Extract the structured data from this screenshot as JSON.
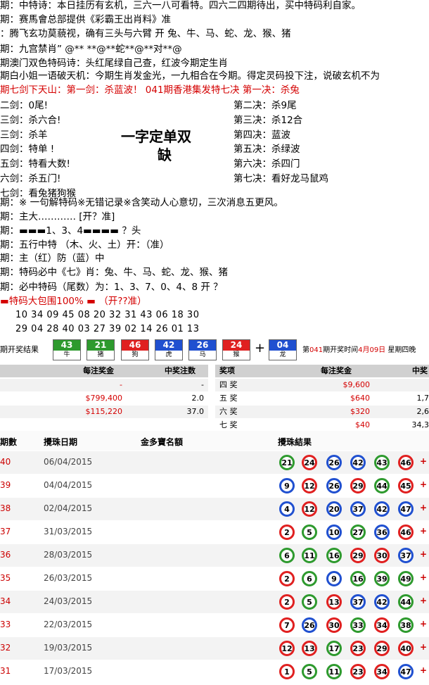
{
  "lines": [
    {
      "text": "期：中特诗：本日挂历有玄机，三六一八可看特。四六二四期待出，买中特码利自家。",
      "color": "#000000"
    },
    {
      "text": "期：赛馬會总部提供《彩霸王出肖料》准",
      "color": "#000000"
    },
    {
      "text": "：腾飞玄功莫藐视，确有三头与六臂        开 兔、牛、马、蛇、龙、猴、猪",
      "color": "#000000"
    },
    {
      "text": "期：九宫禁肖” @** **@**蛇**@**对**@",
      "color": "#000000"
    },
    {
      "text": "期澳门双色特码诗：头红尾绿自己查，红波今期定生肖",
      "color": "#000000"
    },
    {
      "text": "期白小姐一语破天机：今期生肖发金光，一九相合在今期。得定灵码投下注，说破玄机不为",
      "color": "#000000"
    },
    {
      "text": "期七剑下天山：第一剑：杀蓝波！      041期香港集发特七决 第一决：杀兔",
      "color": "#d40000"
    }
  ],
  "swords": [
    {
      "left": "二剑：0尾!",
      "right": "第二决：杀9尾"
    },
    {
      "left": "三剑：杀六合!",
      "right": "第三决：杀12合"
    },
    {
      "left": "三剑：杀羊",
      "right": "第四决：蓝波"
    },
    {
      "left": "四剑：特单 !",
      "right": "第五决：杀绿波"
    },
    {
      "left": "五剑：特看大数!",
      "right": "第六决：杀四门"
    },
    {
      "left": "六剑：杀五门!",
      "right": "第七决：看好龙马鼠鸡"
    },
    {
      "left": "七剑：看兔猪狗猴",
      "right": ""
    }
  ],
  "big_text_1": "一字定单双",
  "big_text_2": "缺",
  "lines2": [
    {
      "text": "期：※ 一句解特码※无错记录※含笑动人心意切，三次消息五更风。",
      "color": "#000000"
    },
    {
      "text": "期：主大………… [开？准]",
      "color": "#000000"
    },
    {
      "text": "期：▬▬▬1、3、4▬▬▬▬ ？头",
      "color": "#000000"
    },
    {
      "text": "期：五行中特  （木、火、土）开：（准）",
      "color": "#000000"
    },
    {
      "text": "期：主（红）防（蓝）中",
      "color": "#000000"
    },
    {
      "text": "期：特码必中《七》肖：兔、牛、马、蛇、龙、猴、猪",
      "color": "#000000"
    },
    {
      "text": "期：必中特码（尾数）为：1、3、7、0、4、8     开 ？",
      "color": "#000000"
    },
    {
      "text": "▬特码大包围100% ▬  （开??准）",
      "color": "#d40000"
    }
  ],
  "numbers_row1": "10 34 09 45 08 20 32 31 43 06 18 30",
  "numbers_row2": "29 04 28 40 03 27 39 02 14 26 01 13",
  "draw": {
    "label": "期开奖结果",
    "balls": [
      {
        "num": "43",
        "zodiac": "牛",
        "color": "#2e9a2e"
      },
      {
        "num": "21",
        "zodiac": "猪",
        "color": "#2e9a2e"
      },
      {
        "num": "46",
        "zodiac": "狗",
        "color": "#e02020"
      },
      {
        "num": "42",
        "zodiac": "虎",
        "color": "#2050d0"
      },
      {
        "num": "26",
        "zodiac": "马",
        "color": "#2050d0"
      },
      {
        "num": "24",
        "zodiac": "猴",
        "color": "#e02020"
      }
    ],
    "special": {
      "num": "04",
      "zodiac": "龙",
      "color": "#2050d0"
    },
    "plus": "+",
    "info_prefix": "第",
    "info_issue": "041",
    "info_mid": "期开奖时间",
    "info_date": "4月09日",
    "info_suffix": "星期四晚"
  },
  "prize_left": {
    "headers": [
      "每注奖金",
      "中奖注数"
    ],
    "rows": [
      {
        "amount": "-",
        "count": "-"
      },
      {
        "amount": "$799,400",
        "count": "2.0"
      },
      {
        "amount": "$115,220",
        "count": "37.0"
      }
    ]
  },
  "prize_right": {
    "headers": [
      "奖项",
      "每注奖金",
      "中奖"
    ],
    "rows": [
      {
        "name": "四 奖",
        "amount": "$9,600",
        "count": ""
      },
      {
        "name": "五 奖",
        "amount": "$640",
        "count": "1,7"
      },
      {
        "name": "六 奖",
        "amount": "$320",
        "count": "2,6"
      },
      {
        "name": "七 奖",
        "amount": "$40",
        "count": "34,3"
      }
    ]
  },
  "history": {
    "headers": [
      "期數",
      "攪珠日期",
      "金多寶名額",
      "攪珠結果"
    ],
    "rows": [
      {
        "no": "40",
        "date": "06/04/2015",
        "balls": [
          "21",
          "24",
          "26",
          "42",
          "43",
          "46"
        ]
      },
      {
        "no": "39",
        "date": "04/04/2015",
        "balls": [
          "9",
          "12",
          "26",
          "29",
          "44",
          "45"
        ]
      },
      {
        "no": "38",
        "date": "02/04/2015",
        "balls": [
          "4",
          "12",
          "20",
          "37",
          "42",
          "47"
        ]
      },
      {
        "no": "37",
        "date": "31/03/2015",
        "balls": [
          "2",
          "5",
          "10",
          "27",
          "36",
          "46"
        ]
      },
      {
        "no": "36",
        "date": "28/03/2015",
        "balls": [
          "6",
          "11",
          "16",
          "29",
          "30",
          "37"
        ]
      },
      {
        "no": "35",
        "date": "26/03/2015",
        "balls": [
          "2",
          "6",
          "9",
          "16",
          "39",
          "49"
        ]
      },
      {
        "no": "34",
        "date": "24/03/2015",
        "balls": [
          "2",
          "5",
          "13",
          "37",
          "42",
          "44"
        ]
      },
      {
        "no": "33",
        "date": "22/03/2015",
        "balls": [
          "7",
          "26",
          "30",
          "33",
          "34",
          "38"
        ]
      },
      {
        "no": "32",
        "date": "19/03/2015",
        "balls": [
          "12",
          "13",
          "17",
          "23",
          "29",
          "40"
        ]
      },
      {
        "no": "31",
        "date": "17/03/2015",
        "balls": [
          "1",
          "5",
          "11",
          "23",
          "34",
          "47"
        ]
      }
    ],
    "plus": "+"
  },
  "colors": {
    "red": "#d40000",
    "ball_red": "#e02020",
    "ball_blue": "#2050d0",
    "ball_green": "#2e9a2e"
  }
}
